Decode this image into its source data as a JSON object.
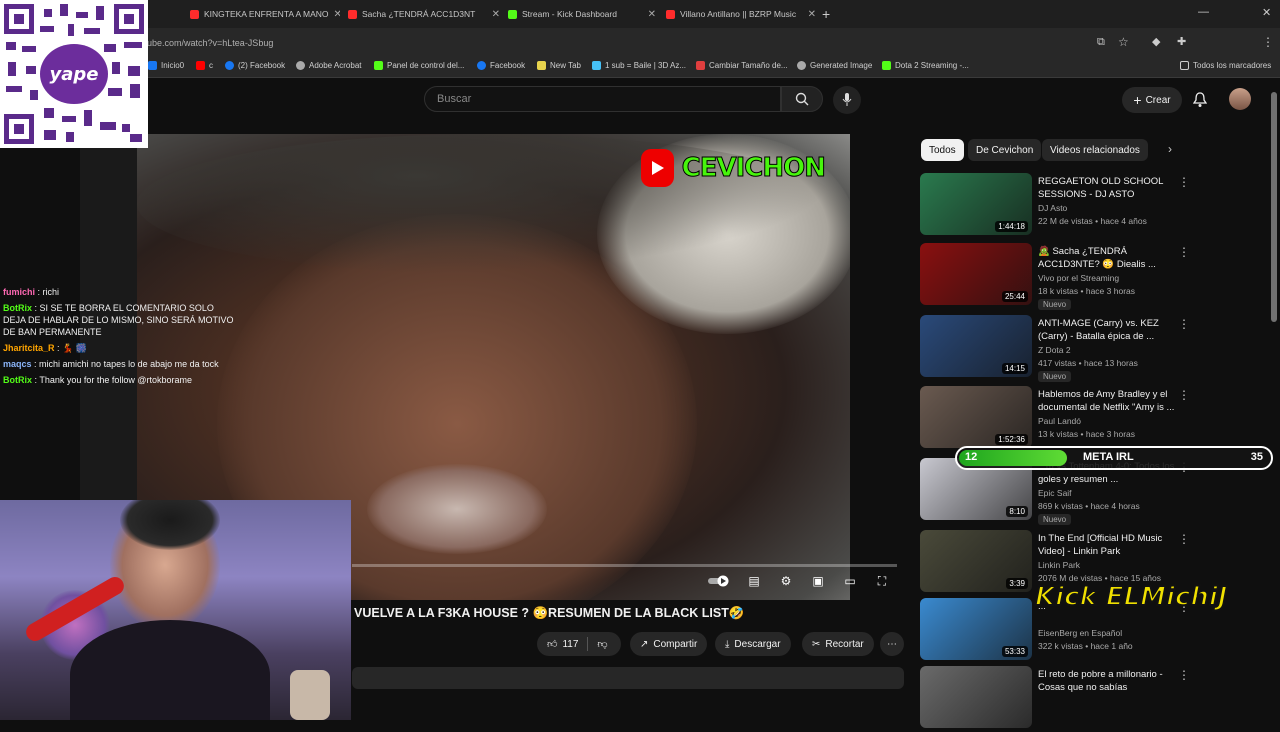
{
  "browser": {
    "tabs": [
      {
        "label": "KINGTEKA ENFRENTA A MANO",
        "color": "#ff2c2c"
      },
      {
        "label": "Sacha ¿TENDRÁ ACC1D3NT",
        "color": "#ff2c2c"
      },
      {
        "label": "Stream - Kick Dashboard",
        "color": "#53fc18"
      },
      {
        "label": "Villano Antillano || BZRP Music",
        "color": "#ff2c2c"
      }
    ],
    "url": "ube.com/watch?v=hLtea-JSbug",
    "bookmarks": [
      {
        "label": "Inicio0",
        "color": "#1877f2"
      },
      {
        "label": "c",
        "color": "#ff0000"
      },
      {
        "label": "(2) Facebook",
        "color": "#1877f2"
      },
      {
        "label": "Adobe Acrobat",
        "color": "#aaaaaa"
      },
      {
        "label": "Panel de control del...",
        "color": "#53fc18"
      },
      {
        "label": "Facebook",
        "color": "#1877f2"
      },
      {
        "label": "New Tab",
        "color": "#e8d44d"
      },
      {
        "label": "1 sub = Baile | 3D Az...",
        "color": "#46c1f7"
      },
      {
        "label": "Cambiar Tamaño de...",
        "color": "#e03e3e"
      },
      {
        "label": "Generated Image",
        "color": "#aaaaaa"
      },
      {
        "label": "Dota 2 Streaming -...",
        "color": "#53fc18"
      }
    ],
    "all_bookmarks": "Todos los marcadores"
  },
  "youtube": {
    "search_placeholder": "Buscar",
    "create_label": "Crear",
    "video_logo_text": "CEVICHON",
    "video_title": "VUELVE A LA F3KA HOUSE ? 😳RESUMEN DE LA BLACK LIST🤣",
    "likes": "117",
    "share_label": "Compartir",
    "download_label": "Descargar",
    "clip_label": "Recortar",
    "chips": [
      "Todos",
      "De Cevichon",
      "Videos relacionados"
    ],
    "recommendations": [
      {
        "title": "REGGAETON OLD SCHOOL SESSIONS - DJ ASTO",
        "channel": "DJ Asto",
        "meta": "22 M de vistas • hace 4 años",
        "duration": "1:44:18",
        "new": "",
        "thumb": "#2a7a4e"
      },
      {
        "title": "🧟 Sacha ¿TENDRÁ ACC1D3NTE? 😳 Diealis ...",
        "channel": "Vivo por el Streaming",
        "meta": "18 k vistas • hace 3 horas",
        "duration": "25:44",
        "new": "Nuevo",
        "thumb": "#8a1010"
      },
      {
        "title": "ANTI-MAGE (Carry) vs. KEZ (Carry) - Batalla épica de ...",
        "channel": "Z Dota 2",
        "meta": "417 vistas • hace 13 horas",
        "duration": "14:15",
        "new": "Nuevo",
        "thumb": "#2a4a7a"
      },
      {
        "title": "Hablemos de Amy Bradley y el documental de Netflix \"Amy is ...",
        "channel": "Paul Landó",
        "meta": "13 k vistas • hace 3 horas",
        "duration": "1:52:36",
        "new": "",
        "thumb": "#6a5a50"
      },
      {
        "title": "...m vs Tottenham 4-0: Todos los goles y resumen ...",
        "channel": "Epic Saif",
        "meta": "869 k vistas • hace 4 horas",
        "duration": "8:10",
        "new": "Nuevo",
        "thumb": "#c8c8d0"
      },
      {
        "title": "In The End [Official HD Music Video] - Linkin Park",
        "channel": "Linkin Park",
        "meta": "2076 M de vistas • hace 15 años",
        "duration": "3:39",
        "new": "",
        "thumb": "#4a4a3a"
      },
      {
        "title": "...",
        "channel": "EisenBerg en Español",
        "meta": "322 k vistas • hace 1 año",
        "duration": "53:33",
        "new": "",
        "thumb": "#3a8ad0"
      },
      {
        "title": "El reto de pobre a millonario - Cosas que no sabías",
        "channel": "",
        "meta": "",
        "duration": "",
        "new": "",
        "thumb": "#6a6a6a"
      }
    ]
  },
  "stream_overlay": {
    "chat": [
      {
        "user": "fumichi",
        "text": "richi",
        "color": "#ff69b4"
      },
      {
        "user": "BotRix",
        "text": "SI SE TE BORRA EL COMENTARIO SOLO DEJA DE HABLAR DE LO MISMO, SINO SERÁ MOTIVO DE BAN PERMANENTE",
        "color": "#53fc18"
      },
      {
        "user": "Jharitcita_R",
        "text": "💃 🎆",
        "color": "#ffa500"
      },
      {
        "user": "maqcs",
        "text": "michi amichi no tapes lo de abajo me da tock",
        "color": "#8ab4f8"
      },
      {
        "user": "BotRix",
        "text": "Thank you for the follow @rtokborame",
        "color": "#53fc18"
      }
    ],
    "goal_label": "META IRL",
    "goal_current": "12",
    "goal_target": "35",
    "goal_fraction": 0.343,
    "kick_brand": "Kick ELMichiJ",
    "qr_label": "yape"
  }
}
